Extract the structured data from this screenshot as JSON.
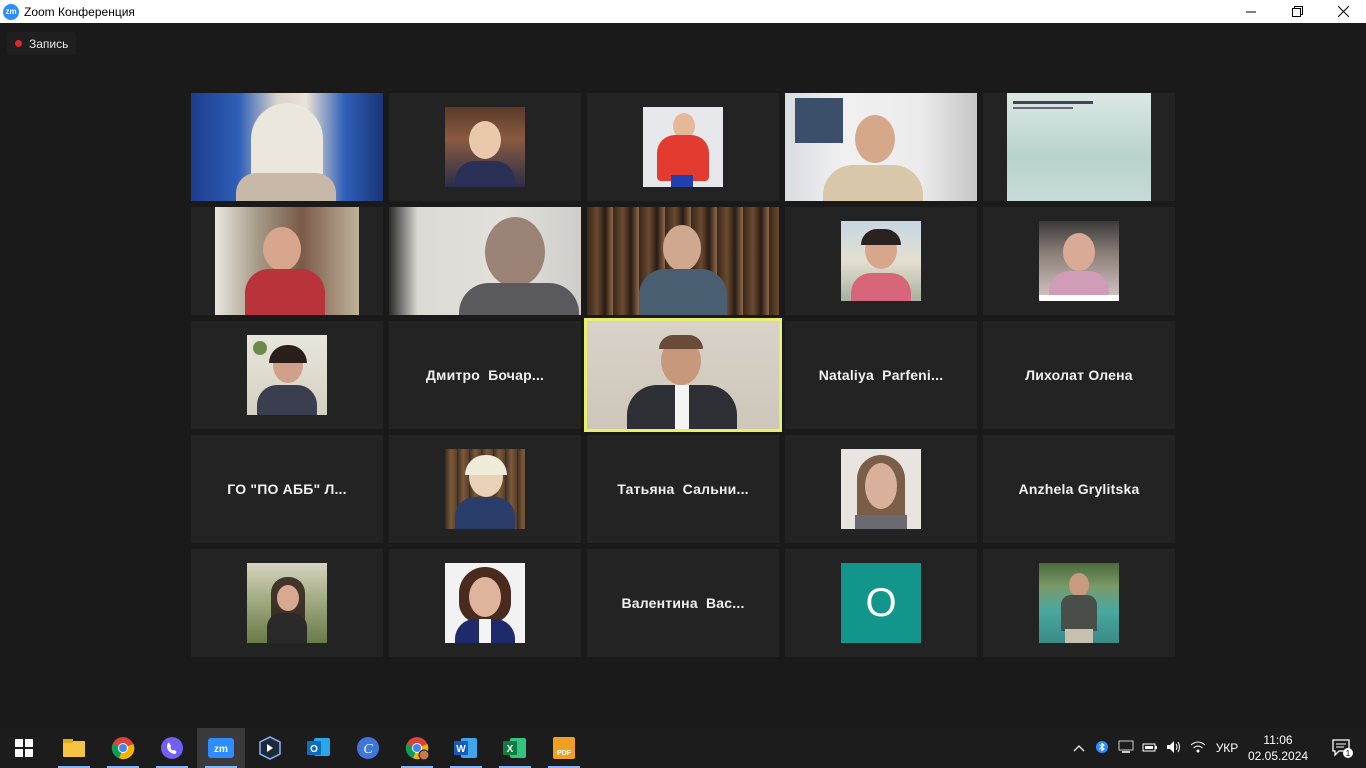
{
  "window": {
    "title": "Zoom Конференция"
  },
  "recording": {
    "label": "Запись",
    "color": "#e02828"
  },
  "colors": {
    "active_speaker_border": "#e8ef6c",
    "avatar_letter_bg": "#12958a",
    "tile_bg": "#232323"
  },
  "participants": [
    {
      "kind": "video",
      "label": ""
    },
    {
      "kind": "photo",
      "label": ""
    },
    {
      "kind": "photo",
      "label": ""
    },
    {
      "kind": "video",
      "label": ""
    },
    {
      "kind": "video",
      "label": ""
    },
    {
      "kind": "video",
      "label": ""
    },
    {
      "kind": "video",
      "label": ""
    },
    {
      "kind": "video",
      "label": ""
    },
    {
      "kind": "photo",
      "label": ""
    },
    {
      "kind": "photo",
      "label": ""
    },
    {
      "kind": "photo",
      "label": ""
    },
    {
      "kind": "name",
      "label": "Дмитро  Бочар..."
    },
    {
      "kind": "video",
      "label": "",
      "active_speaker": true
    },
    {
      "kind": "name",
      "label": "Nataliya  Parfeni..."
    },
    {
      "kind": "name",
      "label": "Лихолат Олена"
    },
    {
      "kind": "name",
      "label": "ГО \"ПО АББ\" Л..."
    },
    {
      "kind": "photo",
      "label": ""
    },
    {
      "kind": "name",
      "label": "Татьяна  Сальни..."
    },
    {
      "kind": "photo",
      "label": ""
    },
    {
      "kind": "name",
      "label": "Anzhela Grylitska"
    },
    {
      "kind": "photo",
      "label": ""
    },
    {
      "kind": "photo",
      "label": ""
    },
    {
      "kind": "name",
      "label": "Валентина  Вас..."
    },
    {
      "kind": "letter",
      "label": "O"
    },
    {
      "kind": "photo",
      "label": ""
    }
  ],
  "taskbar": {
    "apps": [
      "start-icon",
      "file-explorer-icon",
      "chrome-icon",
      "viber-icon",
      "zoom-icon",
      "app-icon",
      "outlook-icon",
      "canva-icon",
      "chrome-profile-icon",
      "word-icon",
      "excel-icon",
      "pdf-icon"
    ],
    "app_letters": {
      "zoom": "zm",
      "word": "W",
      "excel": "X",
      "pdf": "PDF",
      "outlook": "O",
      "canva": "C"
    },
    "language": "УКР",
    "time": "11:06",
    "date": "02.05.2024",
    "notifications": "1"
  }
}
